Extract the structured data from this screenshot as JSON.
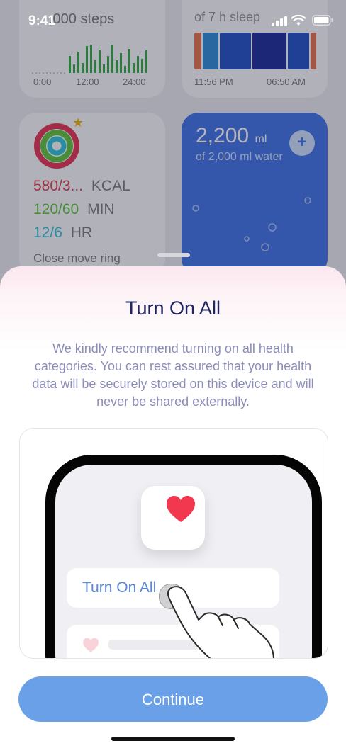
{
  "status_bar": {
    "time": "9:41"
  },
  "background": {
    "steps_card": {
      "value_partial": ",000 steps",
      "times": [
        "0:00",
        "12:00",
        "24:00"
      ]
    },
    "sleep_card": {
      "subtitle": "of 7 h sleep",
      "start": "11:56 PM",
      "end": "06:50 AM"
    },
    "activity_card": {
      "move": "580/3...",
      "move_unit": "KCAL",
      "exercise": "120/60",
      "exercise_unit": "MIN",
      "stand": "12/6",
      "stand_unit": "HR",
      "note": "Close move ring"
    },
    "water_card": {
      "value": "2,200",
      "unit": "ml",
      "subtitle": "of 2,000 ml water",
      "add_symbol": "+"
    }
  },
  "sheet": {
    "title": "Turn On All",
    "description": "We kindly recommend turning on all health categories. You can rest assured that your health data will be securely stored on this device and will never be shared externally.",
    "illustration": {
      "button_label": "Turn On All"
    },
    "continue_label": "Continue"
  },
  "colors": {
    "accent": "#6aa0e8",
    "title": "#1f2560",
    "body_text": "#8c8db9",
    "water": "#3d73e8"
  }
}
